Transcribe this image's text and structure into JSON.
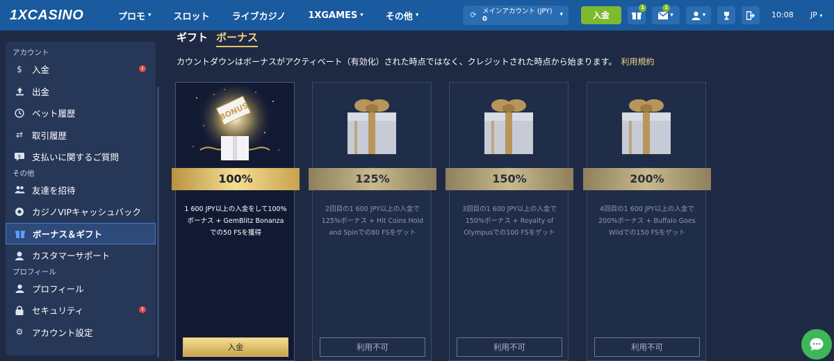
{
  "header": {
    "logo": "1XCASINO",
    "nav": [
      {
        "label": "プロモ",
        "has_dropdown": true
      },
      {
        "label": "スロット",
        "has_dropdown": false
      },
      {
        "label": "ライブカジノ",
        "has_dropdown": false
      },
      {
        "label": "1XGAMES",
        "has_dropdown": true
      },
      {
        "label": "その他",
        "has_dropdown": true
      }
    ],
    "account": {
      "label": "メインアカウント (JPY)",
      "balance": "0"
    },
    "deposit_label": "入金",
    "gift_badge": "1",
    "mail_badge": "1",
    "time": "10:08",
    "language": "JP"
  },
  "sidebar": {
    "sections": [
      {
        "title": "アカウント",
        "items": [
          {
            "label": "入金",
            "icon": "dollar-icon",
            "alert": "!"
          },
          {
            "label": "出金",
            "icon": "upload-icon"
          },
          {
            "label": "ベット履歴",
            "icon": "clock-icon"
          },
          {
            "label": "取引履歴",
            "icon": "transfer-arrows-icon"
          },
          {
            "label": "支払いに関するご質問",
            "icon": "payment-question-icon"
          }
        ]
      },
      {
        "title": "その他",
        "items": [
          {
            "label": "友達を招待",
            "icon": "users-icon"
          },
          {
            "label": "カジノVIPキャッシュバック",
            "icon": "vip-cashback-icon"
          },
          {
            "label": "ボーナス＆ギフト",
            "icon": "gift-icon",
            "active": true
          },
          {
            "label": "カスタマーサポート",
            "icon": "support-icon"
          }
        ]
      },
      {
        "title": "プロフィール",
        "items": [
          {
            "label": "プロフィール",
            "icon": "user-icon"
          },
          {
            "label": "セキュリティ",
            "icon": "lock-icon",
            "alert": "!"
          },
          {
            "label": "アカウント設定",
            "icon": "gear-icon"
          }
        ]
      }
    ]
  },
  "main": {
    "tabs": [
      {
        "label": "ギフト",
        "active": false
      },
      {
        "label": "ボーナス",
        "active": true
      }
    ],
    "notice": "カウントダウンはボーナスがアクティベート（有効化）された時点ではなく、クレジットされた時点から始まります。",
    "terms_link": "利用規約",
    "cards": [
      {
        "percent": "100%",
        "description": "1 600 JPY以上の入金をして100%ボーナス + GemBlitz Bonanzaでの50 FSを獲得",
        "cta": "入金",
        "active": true,
        "bonus_text": "BONUS"
      },
      {
        "percent": "125%",
        "description": "2回目の1 600 JPY以上の入金で125%ボーナス + Hit Coins Hold and Spinでの80 FSをゲット",
        "cta": "利用不可",
        "active": false
      },
      {
        "percent": "150%",
        "description": "3回目の1 600 JPY以上の入金で150%ボーナス + Royalty of Olympusでの100 FSをゲット",
        "cta": "利用不可",
        "active": false
      },
      {
        "percent": "200%",
        "description": "4回目の1 600 JPY以上の入金で200%ボーナス + Buffalo Goes Wildでの150 FSをゲット",
        "cta": "利用不可",
        "active": false
      }
    ]
  },
  "colors": {
    "header_bg": "#1a5a9e",
    "page_bg": "#1e2a44",
    "accent_gold": "#e7c767",
    "deposit_green": "#7dba2e",
    "chat_green": "#3fb65a"
  }
}
